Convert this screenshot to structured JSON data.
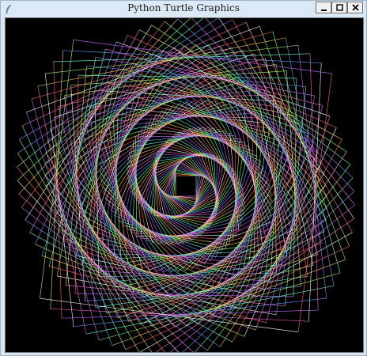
{
  "window": {
    "title": "Python Turtle Graphics",
    "icon": "feather-icon",
    "controls": {
      "minimize": "minimize-icon",
      "maximize": "maximize-icon",
      "close": "close-icon"
    }
  },
  "canvas": {
    "background": "#000000",
    "drawing": "spiral of rotating multicolored squares",
    "palette": [
      "#ff6b6b",
      "#ffd36b",
      "#9bff6b",
      "#6bffd8",
      "#6b9bff",
      "#c56bff",
      "#ff6bd1",
      "#ffffff"
    ]
  }
}
